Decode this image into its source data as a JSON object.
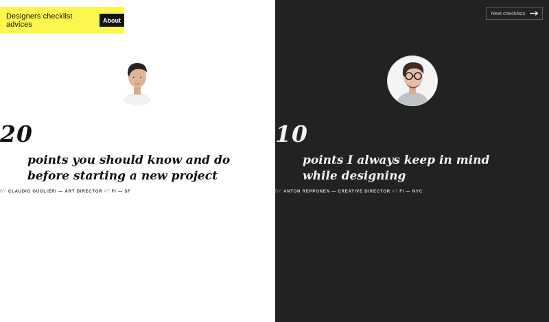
{
  "header": {
    "brand_title": "Designers checklist advices",
    "about_label": "About",
    "next_label": "Next checklists"
  },
  "checklists": [
    {
      "count": "20",
      "title": "points you should know and do before starting a new project",
      "byline_by": "BY",
      "byline_name": "CLAUDIO GUGLIERI",
      "byline_sep1": "—",
      "byline_role": "ART DIRECTOR",
      "byline_at": "AT",
      "byline_company": "FI",
      "byline_sep2": "—",
      "byline_city": "SF"
    },
    {
      "count": "10",
      "title": "points I always keep in mind while designing",
      "byline_by": "BY",
      "byline_name": "ANTON REPPONEN",
      "byline_sep1": "—",
      "byline_role": "CREATIVE DIRECTOR",
      "byline_at": "AT",
      "byline_company": "FI",
      "byline_sep2": "—",
      "byline_city": "NYC"
    }
  ],
  "colors": {
    "accent_yellow": "#fbf74c",
    "dark_panel": "#222222"
  }
}
